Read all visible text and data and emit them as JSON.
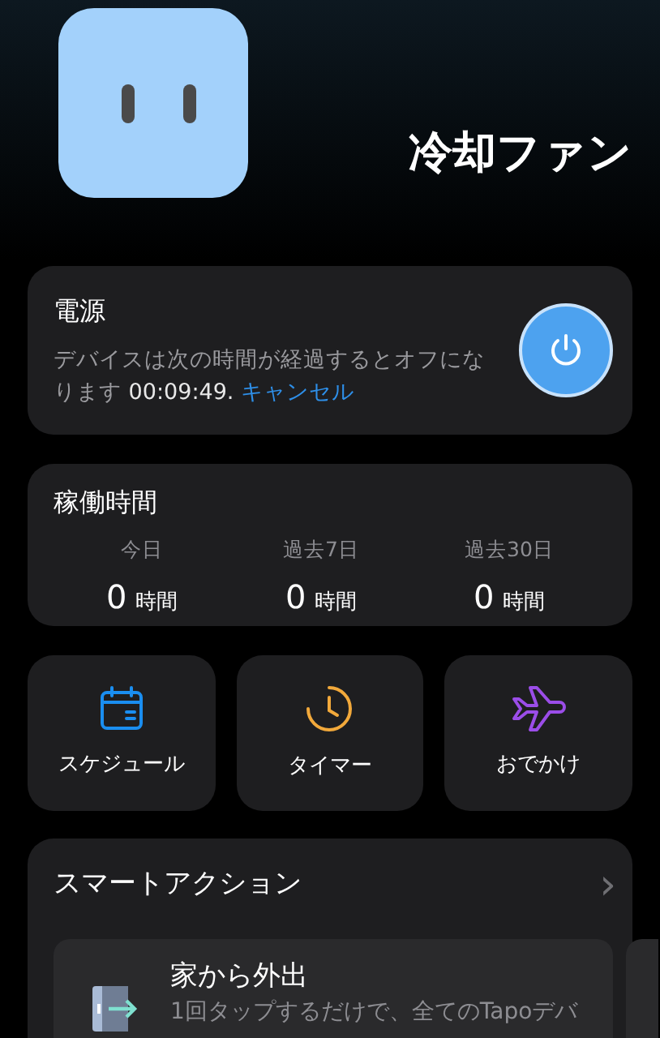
{
  "device": {
    "name": "冷却ファン"
  },
  "power": {
    "title": "電源",
    "on": true,
    "message": "デバイスは次の時間が経過するとオフになります",
    "countdown": "00:09:49.",
    "cancel_link": "キャンセル"
  },
  "runtime": {
    "title": "稼働時間",
    "periods": [
      {
        "label": "今日",
        "value": "0",
        "unit": "時間"
      },
      {
        "label": "過去7日",
        "value": "0",
        "unit": "時間"
      },
      {
        "label": "過去30日",
        "value": "0",
        "unit": "時間"
      }
    ]
  },
  "shortcuts": [
    {
      "kind": "schedule",
      "label": "スケジュール"
    },
    {
      "kind": "timer",
      "label": "タイマー"
    },
    {
      "kind": "away",
      "label": "おでかけ"
    }
  ],
  "smart_actions": {
    "title": "スマートアクション",
    "chevron": "›",
    "actions": [
      {
        "title": "家から外出",
        "description": "1回タップするだけで、全てのTapoデバ"
      }
    ]
  }
}
